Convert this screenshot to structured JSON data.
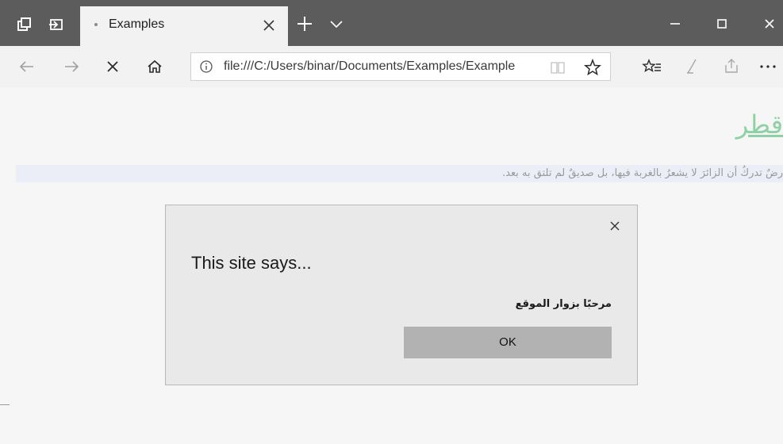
{
  "browser": {
    "tab": {
      "title": "Examples"
    },
    "address_bar": {
      "url": "file:///C:/Users/binar/Documents/Examples/Example"
    },
    "icons": {
      "tab_actions": "tab-actions-icon",
      "set_aside": "set-aside-tabs-icon",
      "tab_close": "close-icon",
      "new_tab": "plus-icon",
      "tab_list": "chevron-down-icon",
      "minimize": "minimize-icon",
      "maximize": "maximize-icon",
      "window_close": "close-icon",
      "back": "back-arrow-icon",
      "forward": "forward-arrow-icon",
      "stop": "stop-icon",
      "home": "home-icon",
      "info": "info-icon",
      "reading_view": "reading-view-icon",
      "favorite": "star-icon",
      "favorites": "favorites-icon",
      "notes": "pen-icon",
      "share": "share-icon",
      "more": "more-icon"
    }
  },
  "page": {
    "heading": "قطر",
    "paragraph": "رضٌ تدركُ أن الزائرَ لا يشعرُ بالغربة فيها، بل صديقٌ لم تلتق به بعد."
  },
  "dialog": {
    "title": "This site says...",
    "message": "مرحبًا بزوار الموقع",
    "ok_label": "OK",
    "colors": {
      "button": "#b2b2b2",
      "background": "#e9e9e9"
    }
  },
  "colors": {
    "titlebar": "#5c5c5c",
    "link_heading": "#8fd1a4"
  }
}
